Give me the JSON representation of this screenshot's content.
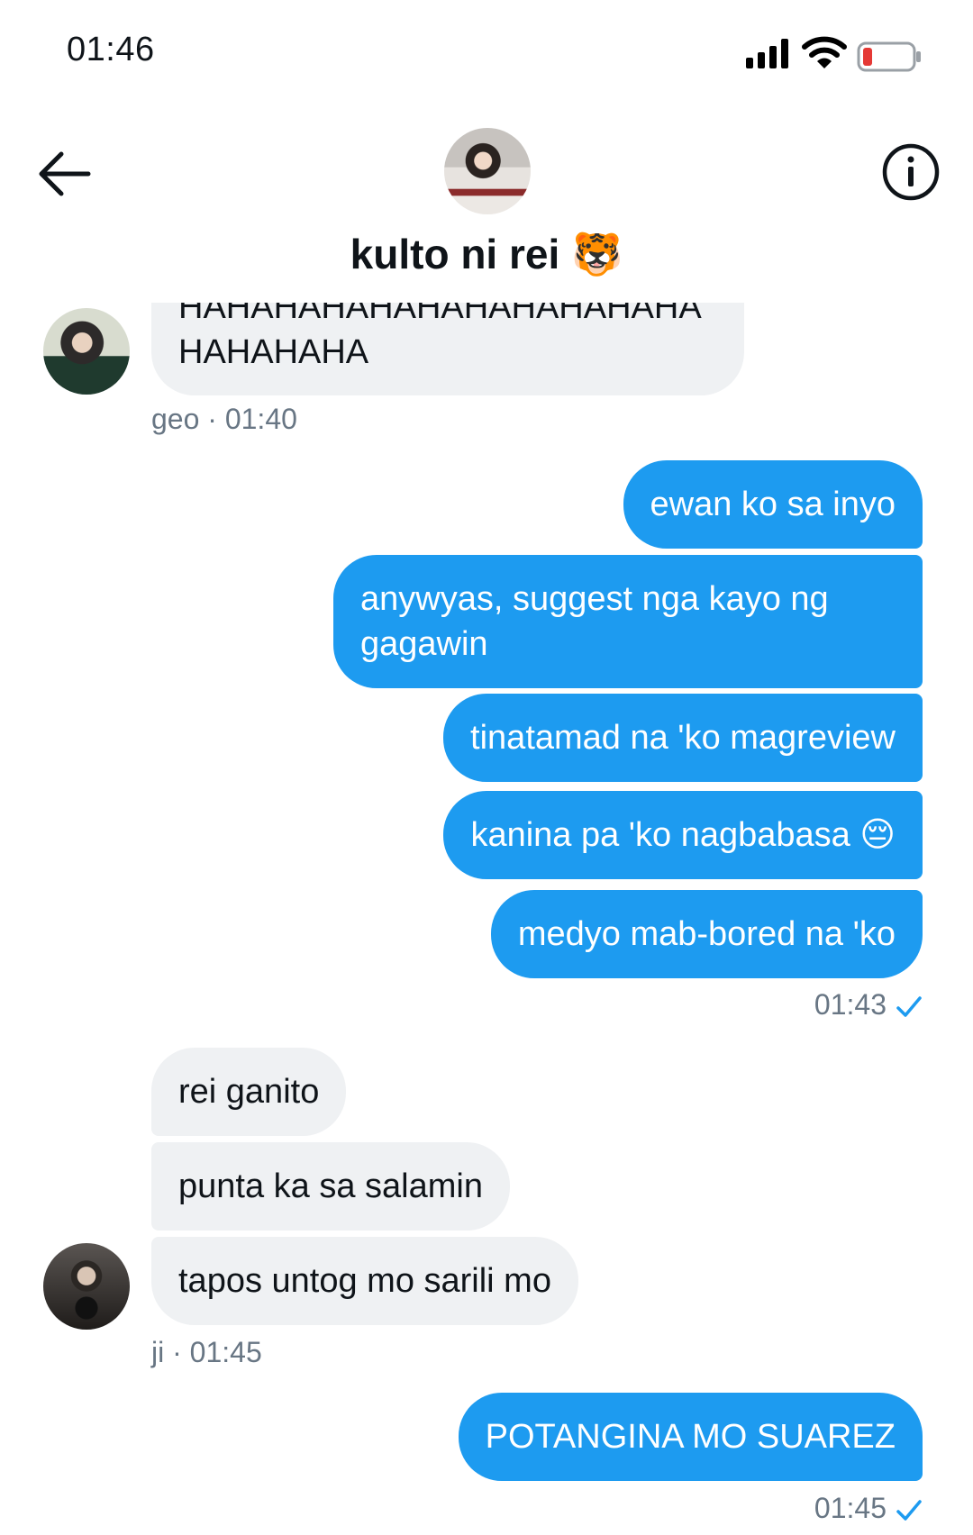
{
  "status_bar": {
    "time": "01:46"
  },
  "header": {
    "title": "kulto ni rei",
    "title_emoji": "🐯"
  },
  "messages": {
    "geo_bubble": "HAHAHAHAHAHAHAHAHAHAHA\nHAHAHAHA",
    "geo_meta": {
      "name": "geo",
      "time": "01:40"
    },
    "out1": [
      "ewan ko sa inyo",
      "anywyas, suggest nga kayo ng gagawin",
      "tinatamad na 'ko magreview",
      "kanina pa 'ko nagbabasa 😔",
      "medyo mab-bored na 'ko"
    ],
    "out1_time": "01:43",
    "ji": [
      "rei ganito",
      "punta ka sa salamin",
      "tapos untog mo sarili mo"
    ],
    "ji_meta": {
      "name": "ji",
      "time": "01:45"
    },
    "out2": "POTANGINA MO SUAREZ",
    "out2_time": "01:45"
  },
  "colors": {
    "accent": "#1d9bf0",
    "incoming_bubble": "#eff1f3",
    "meta": "#687684"
  },
  "icons": [
    "back-arrow-icon",
    "info-icon",
    "signal-icon",
    "wifi-icon",
    "battery-icon",
    "read-check-icon"
  ]
}
